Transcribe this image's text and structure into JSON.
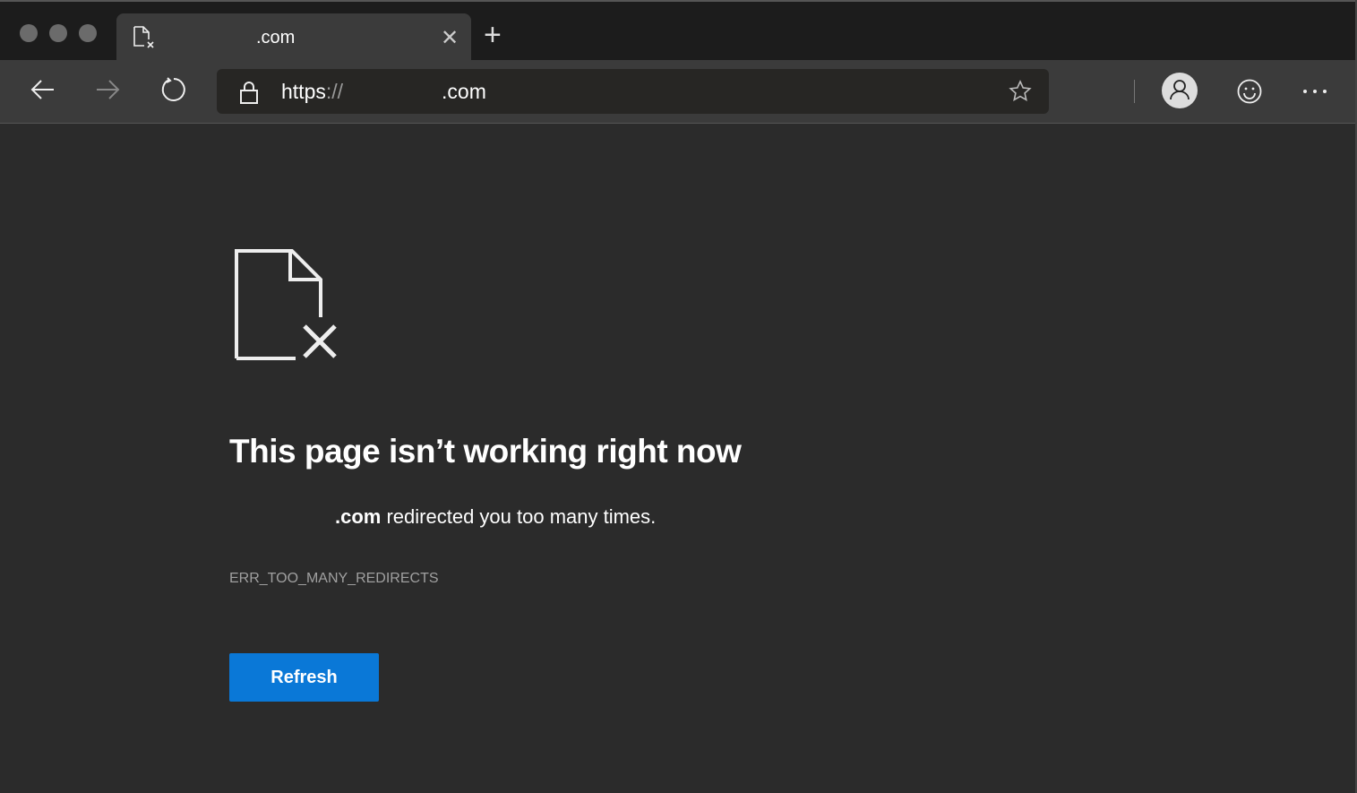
{
  "tab": {
    "title": ".com",
    "icon": "page-error-icon"
  },
  "address_bar": {
    "scheme": "https",
    "separator": "://",
    "domain": ".com"
  },
  "toolbar": {
    "icons": [
      "back-icon",
      "forward-icon",
      "refresh-icon",
      "lock-icon",
      "star-icon",
      "profile-icon",
      "emoji-icon",
      "more-icon"
    ]
  },
  "error": {
    "title": "This page isn’t working right now",
    "message_domain": ".com",
    "message_text": " redirected you too many times.",
    "code": "ERR_TOO_MANY_REDIRECTS",
    "button_label": "Refresh"
  },
  "colors": {
    "accent": "#0a78d7",
    "background": "#2b2b2b"
  }
}
